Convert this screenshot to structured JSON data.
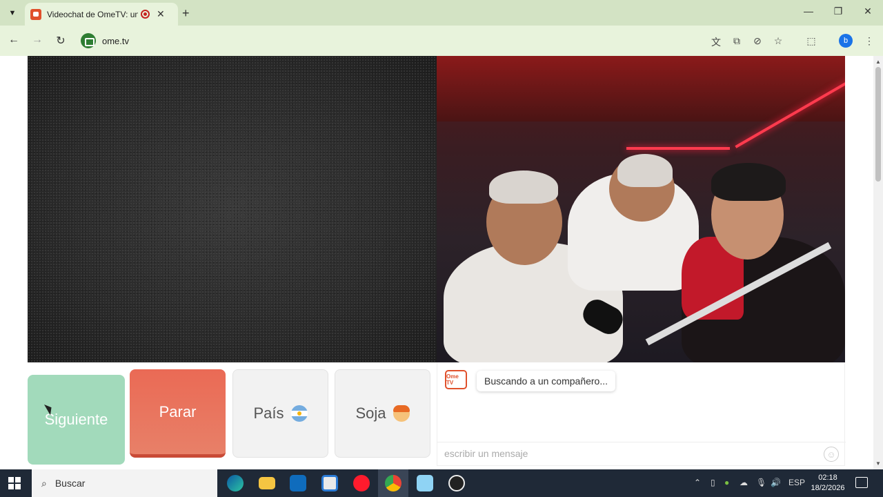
{
  "browser": {
    "tab_title": "Videochat de OmeTV: una a",
    "url": "ome.tv",
    "profile_initial": "b",
    "icons": [
      "tab-search-icon",
      "recording-icon",
      "close-icon",
      "new-tab-icon",
      "minimize-icon",
      "restore-icon",
      "window-close-icon",
      "back-icon",
      "forward-icon",
      "reload-icon",
      "translate-icon",
      "install-icon",
      "tracking-protection-icon",
      "bookmark-star-icon",
      "extensions-icon",
      "menu-icon"
    ]
  },
  "controls": {
    "next_label": "Siguiente",
    "stop_label": "Parar",
    "country_label": "País",
    "gender_label": "Soja",
    "country_flag": "argentina-flag-icon",
    "gender_icon": "boy-emoji-icon"
  },
  "chat": {
    "logo_text": "Ome TV",
    "status_message": "Buscando a un compañero...",
    "input_placeholder": "escribir un mensaje"
  },
  "taskbar": {
    "search_label": "Buscar",
    "language": "ESP",
    "time": "02:18",
    "date": "18/2/2026",
    "apps": [
      "edge-icon",
      "file-explorer-icon",
      "outlook-icon",
      "store-icon",
      "opera-icon",
      "chrome-icon",
      "notepad-icon",
      "obs-icon"
    ]
  },
  "colors": {
    "next_button": "#a2dabb",
    "stop_button": "#ea6a55",
    "brand": "#e0502b"
  }
}
